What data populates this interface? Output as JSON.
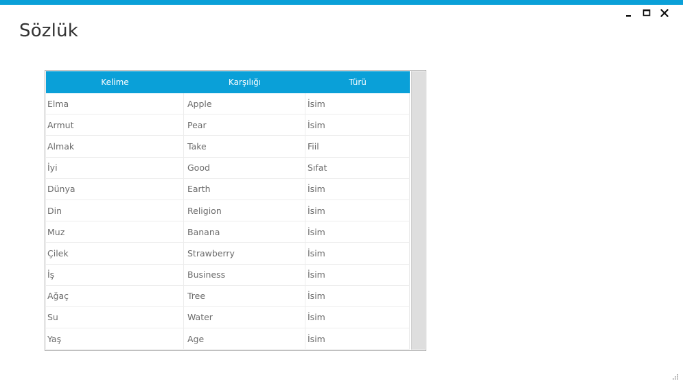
{
  "window": {
    "title": "Sözlük",
    "accent_color": "#0aa0d8",
    "controls": [
      "minimize-icon",
      "maximize-icon",
      "close-icon"
    ]
  },
  "grid": {
    "columns": [
      "Kelime",
      "Karşılığı",
      "Türü"
    ],
    "rows": [
      [
        "Elma",
        "Apple",
        "İsim"
      ],
      [
        "Armut",
        "Pear",
        "İsim"
      ],
      [
        "Almak",
        "Take",
        "Fiil"
      ],
      [
        "İyi",
        "Good",
        "Sıfat"
      ],
      [
        "Dünya",
        "Earth",
        "İsim"
      ],
      [
        "Din",
        "Religion",
        "İsim"
      ],
      [
        "Muz",
        "Banana",
        "İsim"
      ],
      [
        "Çilek",
        "Strawberry",
        "İsim"
      ],
      [
        "İş",
        "Business",
        "İsim"
      ],
      [
        "Ağaç",
        "Tree",
        "İsim"
      ],
      [
        "Su",
        "Water",
        "İsim"
      ],
      [
        "Yaş",
        "Age",
        "İsim"
      ]
    ]
  }
}
